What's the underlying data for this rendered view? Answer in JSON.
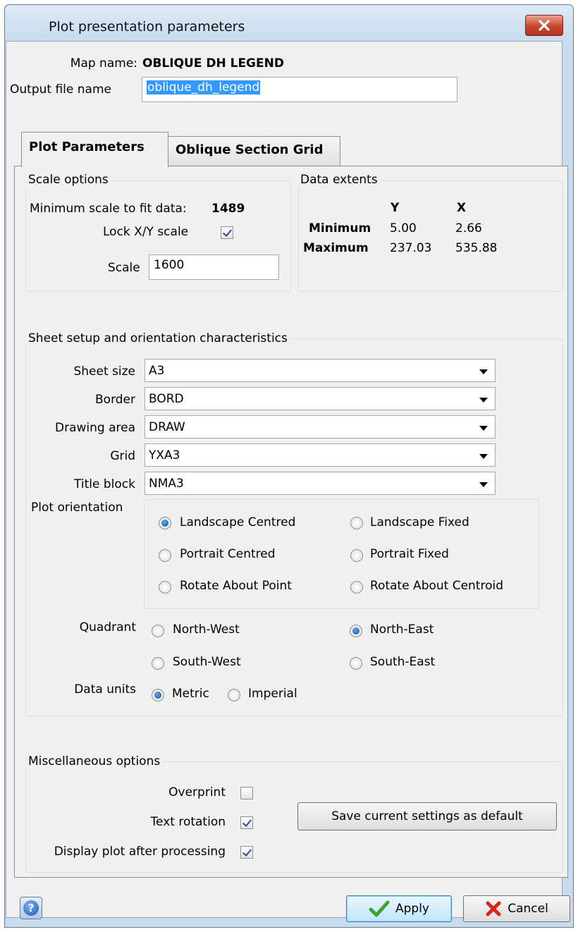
{
  "window": {
    "title": "Plot presentation parameters"
  },
  "header": {
    "map_name_label": "Map name:",
    "map_name_value": "OBLIQUE DH LEGEND",
    "output_file_label": "Output file name",
    "output_file_value": "oblique_dh_legend"
  },
  "tabs": [
    {
      "label": "Plot Parameters",
      "active": true
    },
    {
      "label": "Oblique Section Grid",
      "active": false
    }
  ],
  "scale_options": {
    "legend": "Scale options",
    "min_scale_label": "Minimum scale to fit data:",
    "min_scale_value": "1489",
    "lock_label": "Lock X/Y scale",
    "lock_checked": true,
    "scale_label": "Scale",
    "scale_value": "1600"
  },
  "data_extents": {
    "legend": "Data extents",
    "col_y": "Y",
    "col_x": "X",
    "min_label": "Minimum",
    "min_y": "5.00",
    "min_x": "2.66",
    "max_label": "Maximum",
    "max_y": "237.03",
    "max_x": "535.88"
  },
  "sheet_setup": {
    "legend": "Sheet setup and orientation characteristics",
    "sheet_size_label": "Sheet size",
    "sheet_size_value": "A3",
    "border_label": "Border",
    "border_value": "BORD",
    "drawing_area_label": "Drawing area",
    "drawing_area_value": "DRAW",
    "grid_label": "Grid",
    "grid_value": "YXA3",
    "title_block_label": "Title block",
    "title_block_value": "NMA3",
    "plot_orientation_label": "Plot orientation",
    "orientation_options": [
      "Landscape Centred",
      "Landscape Fixed",
      "Portrait Centred",
      "Portrait Fixed",
      "Rotate About Point",
      "Rotate About Centroid"
    ],
    "orientation_selected": "Landscape Centred",
    "quadrant_label": "Quadrant",
    "quadrant_options": [
      "North-West",
      "North-East",
      "South-West",
      "South-East"
    ],
    "quadrant_selected": "North-East",
    "data_units_label": "Data units",
    "data_units_options": [
      "Metric",
      "Imperial"
    ],
    "data_units_selected": "Metric"
  },
  "misc": {
    "legend": "Miscellaneous options",
    "overprint_label": "Overprint",
    "overprint_checked": false,
    "text_rotation_label": "Text rotation",
    "text_rotation_checked": true,
    "display_plot_label": "Display plot after processing",
    "display_plot_checked": true,
    "save_defaults_label": "Save current settings as default"
  },
  "footer": {
    "help_glyph": "?",
    "apply_label": "Apply",
    "cancel_label": "Cancel"
  },
  "colors": {
    "selection": "#3399ff",
    "apply_check": "#3aa52c",
    "cancel_x": "#d9261c"
  }
}
